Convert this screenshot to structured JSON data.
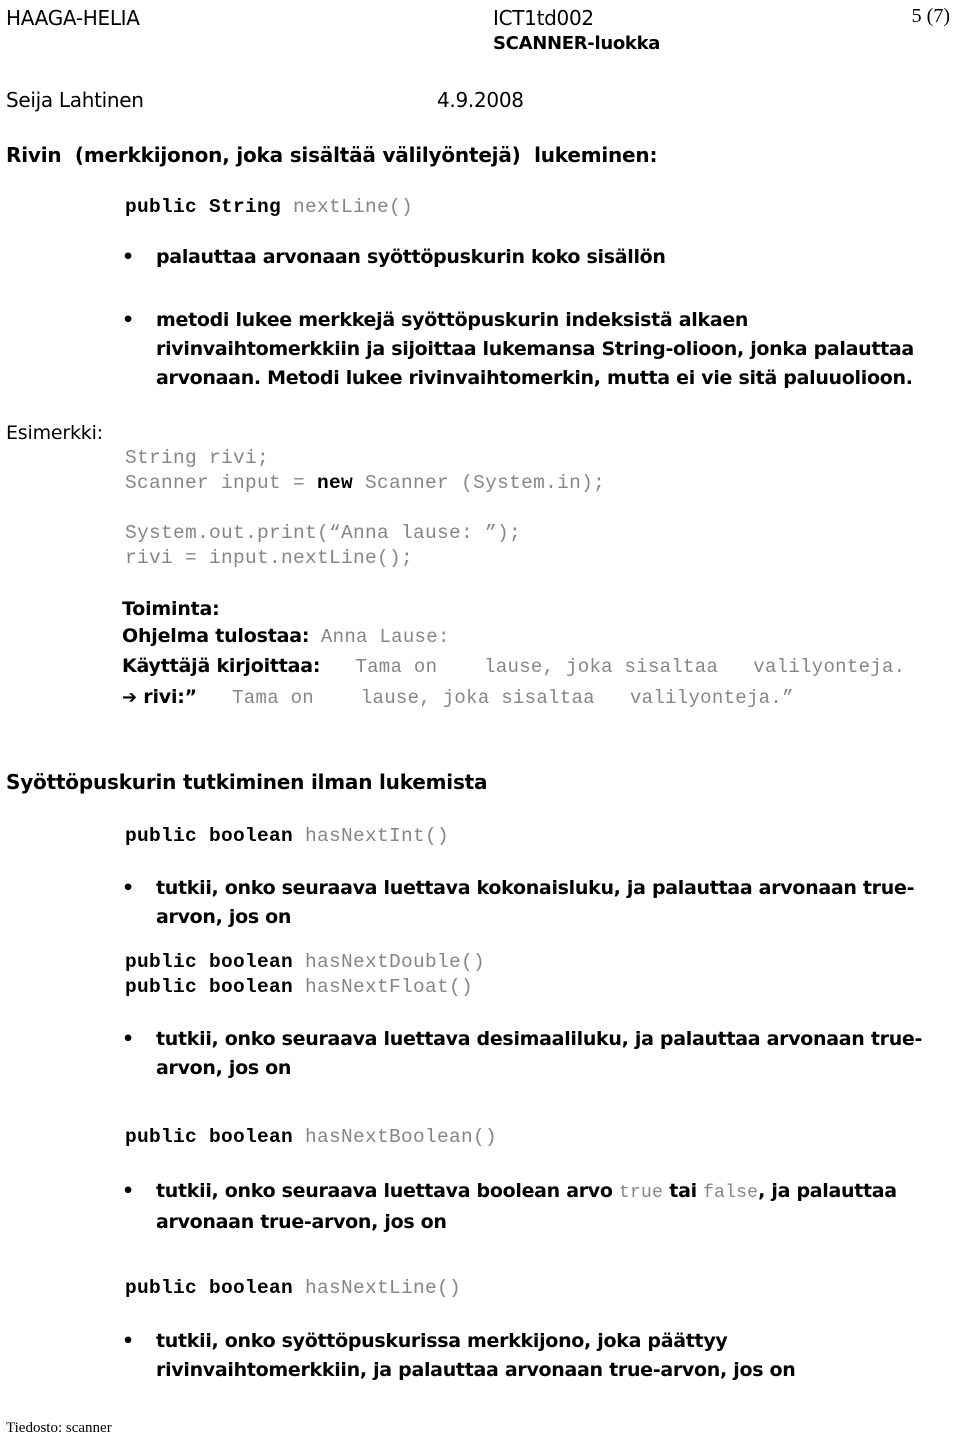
{
  "header": {
    "organization": "HAAGA-HELIA",
    "course_code": "ICT1td002",
    "course_topic": "SCANNER-luokka",
    "page_number": "5 (7)",
    "author": "Seija Lahtinen",
    "date": "4.9.2008"
  },
  "sections": [
    {
      "heading": "Rivin  (merkkijonon, joka sisältää välilyöntejä)  lukeminen:",
      "signature_bold": "public String ",
      "signature_rest": "nextLine()",
      "bullets": [
        "palauttaa arvonaan syöttöpuskurin koko sisällön",
        "metodi lukee merkkejä syöttöpuskurin indeksistä alkaen rivinvaihtomerkkiin ja sijoittaa lukemansa String-olioon, jonka palauttaa arvonaan. Metodi lukee rivinvaihtomerkin, mutta ei vie sitä paluuolioon."
      ]
    }
  ],
  "example": {
    "label": "Esimerkki:",
    "line1": "String rivi;",
    "line2_a": "Scanner input = ",
    "line2_b": "new",
    "line2_c": " Scanner (System.in);",
    "line3": "System.out.print(“Anna lause: ”);",
    "line4": "rivi = input.nextLine();"
  },
  "behaviour": {
    "title": "Toiminta:",
    "prints_label": "Ohjelma tulostaa:",
    "prints_value": " Anna Lause:",
    "user_types_label": "Käyttäjä kirjoittaa:",
    "user_types_value": "   Tama on    lause, joka sisaltaa   valilyonteja.",
    "arrow": "➔",
    "result_label": " rivi:”",
    "result_value": "   Tama on    lause, joka sisaltaa   valilyonteja.”"
  },
  "section2": {
    "heading": "Syöttöpuskurin tutkiminen ilman lukemista",
    "methods": [
      {
        "signature_bold": "public boolean ",
        "signature_rest": "hasNextInt()",
        "bullet": "tutkii, onko seuraava luettava kokonaisluku, ja palauttaa arvonaan true-arvon, jos on"
      },
      {
        "signature_bold": "public boolean ",
        "signature_rest": "hasNextDouble()",
        "signature_bold2": "public boolean ",
        "signature_rest2": "hasNextFloat()",
        "bullet": "tutkii, onko seuraava luettava desimaaliluku, ja palauttaa arvonaan true-arvon, jos on"
      },
      {
        "signature_bold": "public boolean ",
        "signature_rest": "hasNextBoolean()",
        "bullet_a": "tutkii, onko seuraava luettava boolean arvo ",
        "bullet_mono1": "true",
        "bullet_b": " tai ",
        "bullet_mono2": "false",
        "bullet_c": ", ja palauttaa arvonaan true-arvon, jos on"
      },
      {
        "signature_bold": "public boolean ",
        "signature_rest": "hasNextLine()",
        "bullet": "tutkii, onko syöttöpuskurissa merkkijono, joka päättyy rivinvaihtomerkkiin, ja palauttaa arvonaan true-arvon, jos on"
      }
    ]
  },
  "footer": {
    "text": "Tiedosto: scanner"
  },
  "icons": {
    "bullet_dot": "•"
  },
  "colors": {
    "text": "#000000",
    "code_gray": "#868686",
    "background": "#ffffff"
  }
}
